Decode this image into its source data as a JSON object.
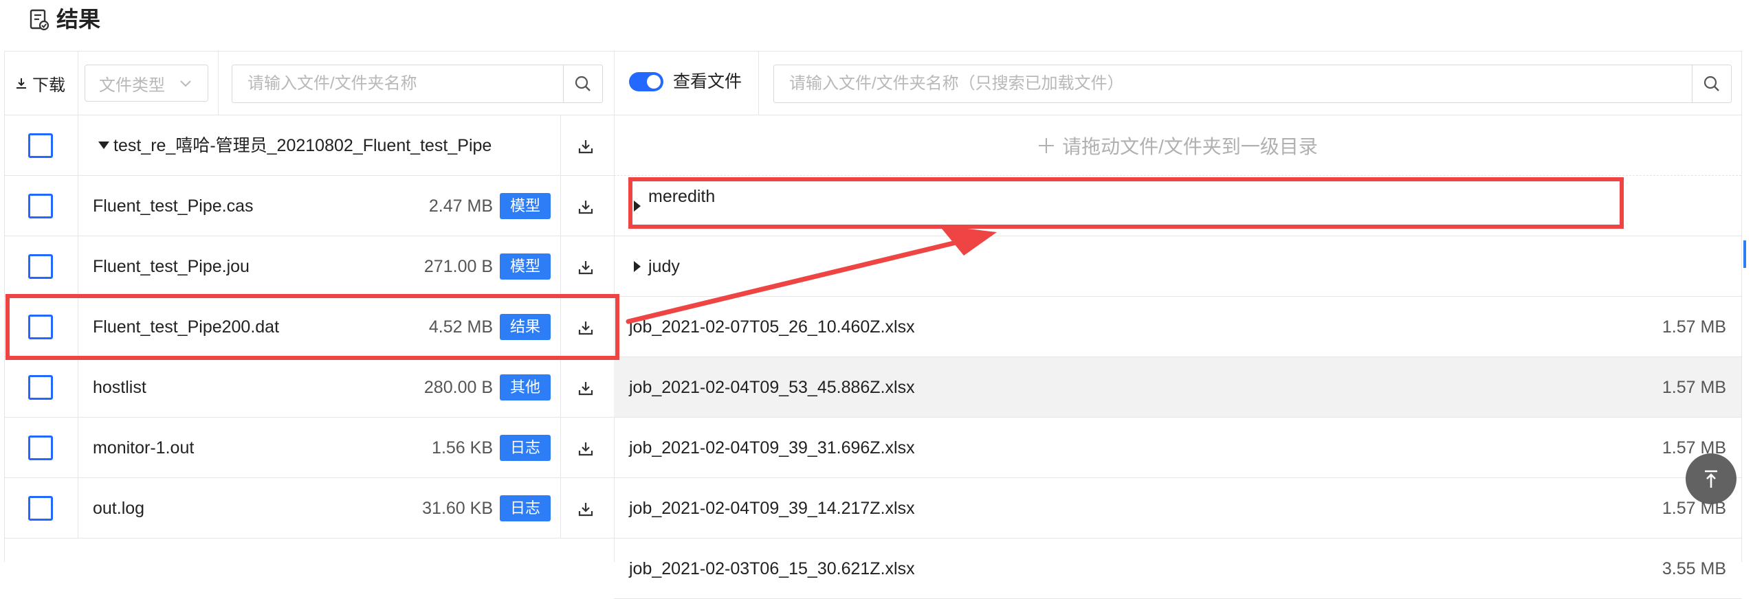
{
  "header": {
    "title": "结果",
    "icon": "result-doc-icon"
  },
  "left_panel": {
    "toolbar": {
      "download_label": "下载",
      "filetype_placeholder": "文件类型",
      "search_placeholder": "请输入文件/文件夹名称"
    },
    "folder": {
      "name": "test_re_嘻哈-管理员_20210802_Fluent_test_Pipe"
    },
    "files": [
      {
        "name": "Fluent_test_Pipe.cas",
        "size": "2.47 MB",
        "tag": "模型"
      },
      {
        "name": "Fluent_test_Pipe.jou",
        "size": "271.00 B",
        "tag": "模型"
      },
      {
        "name": "Fluent_test_Pipe200.dat",
        "size": "4.52 MB",
        "tag": "结果"
      },
      {
        "name": "hostlist",
        "size": "280.00 B",
        "tag": "其他"
      },
      {
        "name": "monitor-1.out",
        "size": "1.56 KB",
        "tag": "日志"
      },
      {
        "name": "out.log",
        "size": "31.60 KB",
        "tag": "日志"
      }
    ]
  },
  "right_panel": {
    "toolbar": {
      "toggle_label": "查看文件",
      "toggle_on": true,
      "search_placeholder": "请输入文件/文件夹名称（只搜索已加载文件）"
    },
    "drop_zone_text": "请拖动文件/文件夹到一级目录",
    "folders": [
      "meredith",
      "judy"
    ],
    "files": [
      {
        "name": "job_2021-02-07T05_26_10.460Z.xlsx",
        "size": "1.57 MB"
      },
      {
        "name": "job_2021-02-04T09_53_45.886Z.xlsx",
        "size": "1.57 MB"
      },
      {
        "name": "job_2021-02-04T09_39_31.696Z.xlsx",
        "size": "1.57 MB"
      },
      {
        "name": "job_2021-02-04T09_39_14.217Z.xlsx",
        "size": "1.57 MB"
      },
      {
        "name": "job_2021-02-03T06_15_30.621Z.xlsx",
        "size": "3.55 MB"
      }
    ]
  },
  "colors": {
    "accent": "#2469ff",
    "tag_bg": "#2c7df6",
    "annotation": "#ee4444"
  }
}
